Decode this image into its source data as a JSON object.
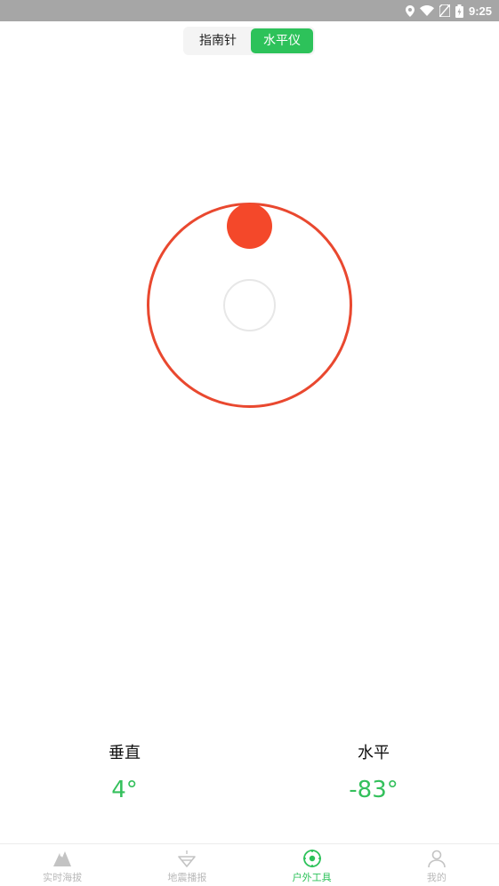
{
  "status_bar": {
    "time": "9:25",
    "icons": [
      "location-icon",
      "wifi-icon",
      "no-sim-icon",
      "battery-charging-icon"
    ]
  },
  "mode_switch": {
    "options": [
      {
        "label": "指南针",
        "active": false
      },
      {
        "label": "水平仪",
        "active": true
      }
    ],
    "active_color": "#2dc25a"
  },
  "level": {
    "ring_color": "#e9482f",
    "bubble_color": "#f4482a",
    "bubble_offset_angle_deg": -90,
    "bubble_at_edge": true
  },
  "readouts": {
    "vertical": {
      "label": "垂直",
      "value": "4°"
    },
    "horizontal": {
      "label": "水平",
      "value": "-83°"
    },
    "value_color": "#34c05c"
  },
  "tabbar": {
    "items": [
      {
        "label": "实时海拔",
        "icon": "mountain-icon",
        "active": false
      },
      {
        "label": "地震播报",
        "icon": "earthquake-icon",
        "active": false
      },
      {
        "label": "户外工具",
        "icon": "compass-target-icon",
        "active": true
      },
      {
        "label": "我的",
        "icon": "user-icon",
        "active": false
      }
    ],
    "active_color": "#2dc25a",
    "inactive_color": "#b9b9b9"
  }
}
